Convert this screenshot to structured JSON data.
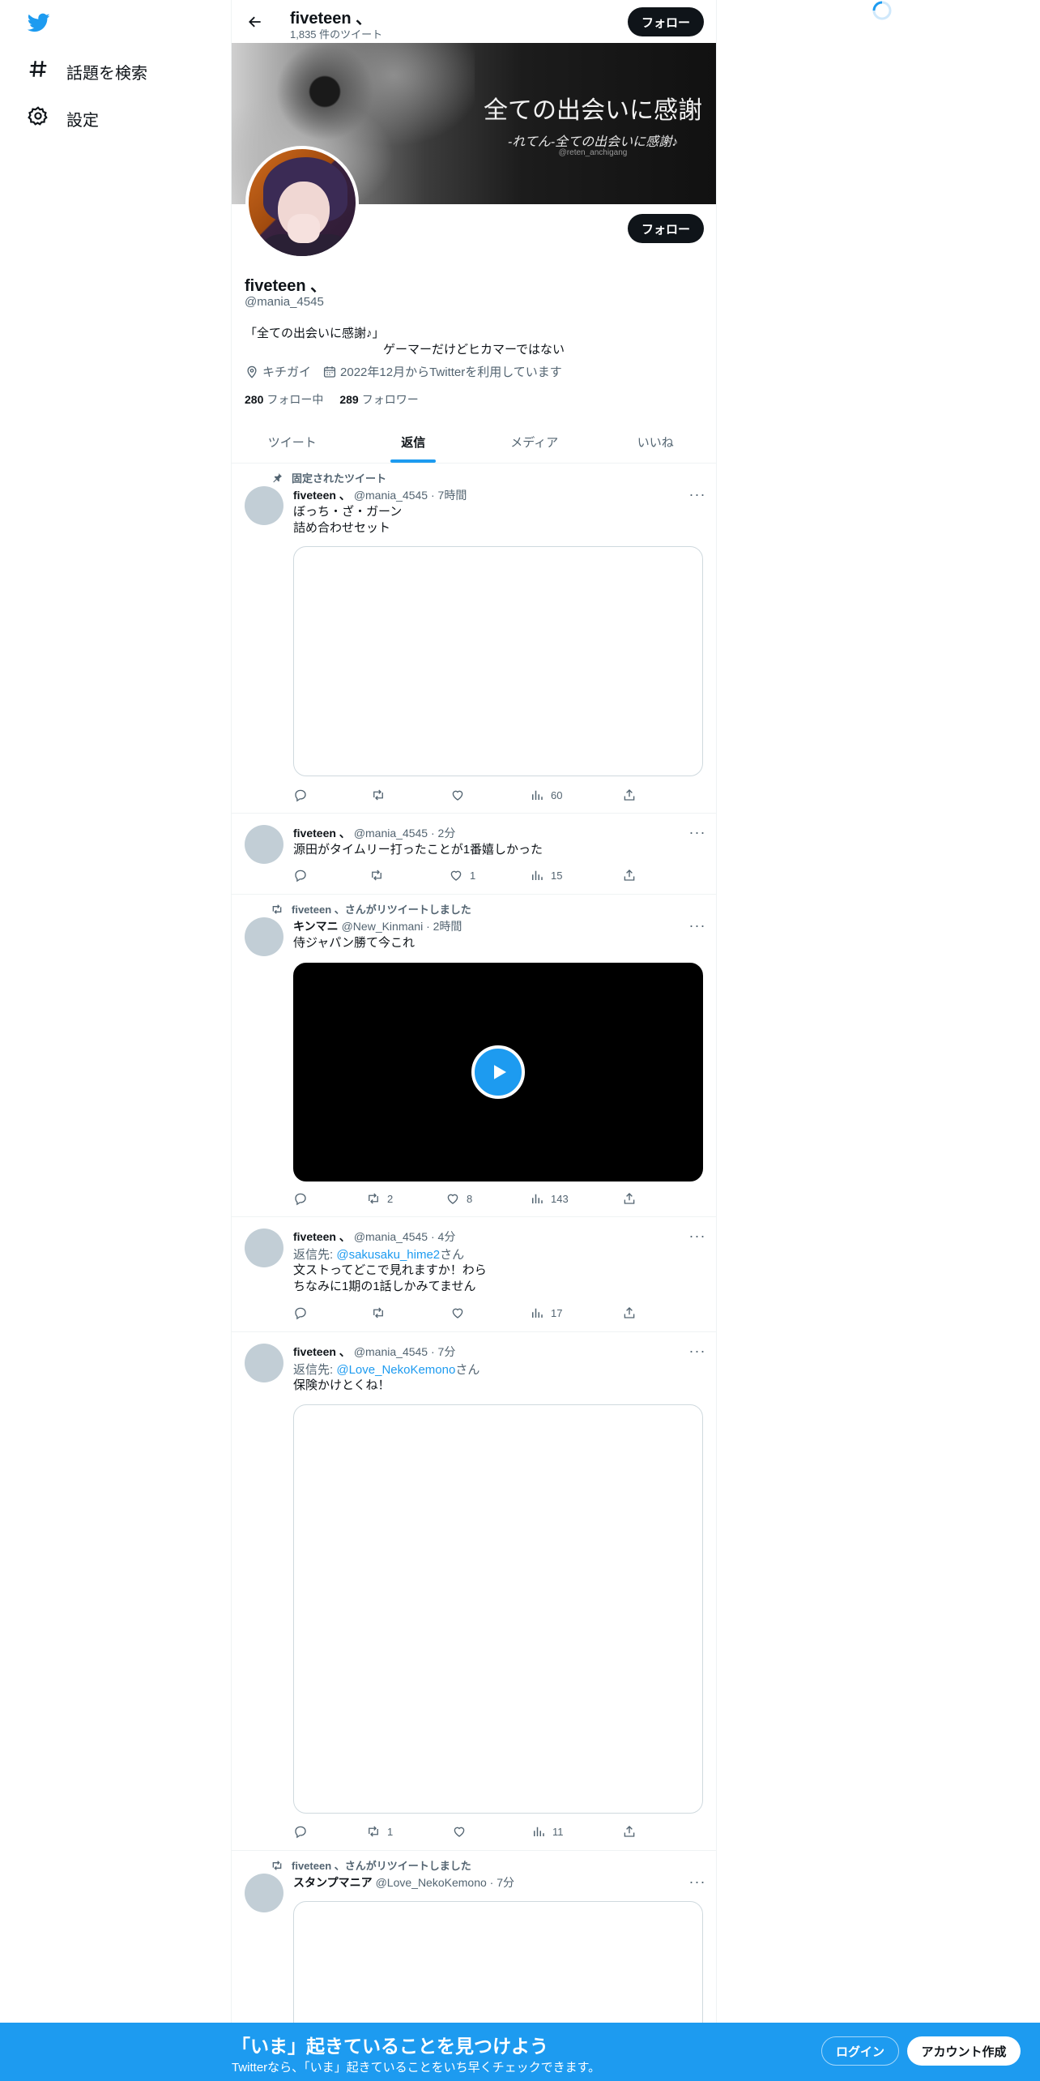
{
  "nav": {
    "logo": "twitter-bird",
    "items": [
      {
        "label": "話題を検索",
        "icon": "hashtag-icon"
      },
      {
        "label": "設定",
        "icon": "gear-icon"
      }
    ]
  },
  "header": {
    "name": "fiveteen 、",
    "tweet_count": "1,835 件のツイート",
    "follow_label": "フォロー"
  },
  "banner": {
    "title": "全ての出会いに感謝",
    "subtitle": "-れてん-全ての出会いに感謝♪",
    "handle": "@reten_anchigang"
  },
  "profile": {
    "follow_label": "フォロー",
    "name": "fiveteen 、",
    "handle": "@mania_4545",
    "bio_line1": "「全ての出会いに感謝♪」",
    "bio_line2": "ゲーマーだけどヒカマーではない",
    "location": "キチガイ",
    "joined": "2022年12月からTwitterを利用しています",
    "following_count": "280",
    "following_label": "フォロー中",
    "followers_count": "289",
    "followers_label": "フォロワー"
  },
  "tabs": [
    {
      "label": "ツイート",
      "active": false
    },
    {
      "label": "返信",
      "active": true
    },
    {
      "label": "メディア",
      "active": false
    },
    {
      "label": "いいね",
      "active": false
    }
  ],
  "tweets": [
    {
      "context": "固定されたツイート",
      "name": "fiveteen 、",
      "meta": "@mania_4545 · 7時間",
      "text_line1": "ぼっち・ざ・ガーン",
      "text_line2": "詰め合わせセット",
      "stats": {
        "replies": "",
        "retweets": "",
        "likes": "",
        "views": "60"
      }
    },
    {
      "name": "fiveteen 、",
      "meta": "@mania_4545 · 2分",
      "text_line1": "源田がタイムリー打ったことが1番嬉しかった",
      "stats": {
        "replies": "",
        "retweets": "",
        "likes": "1",
        "views": "15"
      }
    },
    {
      "context": "fiveteen 、さんがリツイートしました",
      "name": "キンマニ",
      "meta": "@New_Kinmani · 2時間",
      "text_line1": "侍ジャパン勝て今これ",
      "stats": {
        "replies": "",
        "retweets": "2",
        "likes": "8",
        "views": "143"
      }
    },
    {
      "name": "fiveteen 、",
      "meta": "@mania_4545 · 4分",
      "reply_prefix": "返信先: ",
      "reply_to": "@sakusaku_hime2",
      "reply_suffix": "さん",
      "text_line1": "文ストってどこで見れますか！わら",
      "text_line2": "ちなみに1期の1話しかみてません",
      "stats": {
        "replies": "",
        "retweets": "",
        "likes": "",
        "views": "17"
      }
    },
    {
      "name": "fiveteen 、",
      "meta": "@mania_4545 · 7分",
      "reply_prefix": "返信先: ",
      "reply_to": "@Love_NekoKemono",
      "reply_suffix": "さん",
      "text_line1": "保険かけとくね！",
      "stats": {
        "replies": "",
        "retweets": "1",
        "likes": "",
        "views": "11"
      }
    },
    {
      "context": "fiveteen 、さんがリツイートしました",
      "name": "スタンプマニア",
      "meta": "@Love_NekoKemono · 7分"
    }
  ],
  "bottom_bar": {
    "title": "「いま」起きていることを見つけよう",
    "subtitle": "Twitterなら、「いま」起きていることをいち早くチェックできます。",
    "login_label": "ログイン",
    "signup_label": "アカウント作成"
  },
  "colors": {
    "accent": "#1d9bf0",
    "dark": "#0f1419",
    "muted": "#536471",
    "bar": "#1d9bf0"
  }
}
